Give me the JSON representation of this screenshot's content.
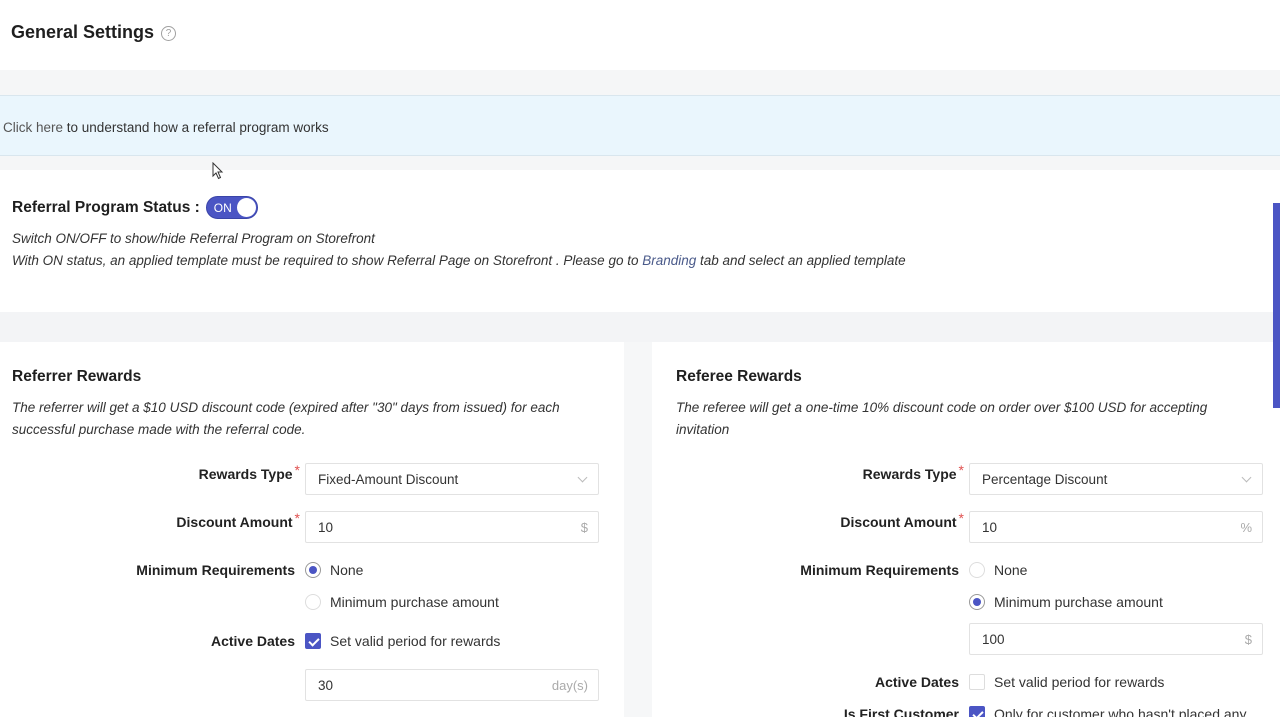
{
  "header": {
    "title": "General Settings",
    "help_icon": "question-circle-icon"
  },
  "info_bar": {
    "link_text": "Click here",
    "text": " to understand how a referral program works"
  },
  "status": {
    "label": "Referral Program Status :",
    "toggle_text": "ON",
    "toggle_on": true,
    "note_line1": "Switch ON/OFF to show/hide Referral Program on Storefront",
    "note_line2_before": "With ON status, an applied template must be required to show Referral Page on Storefront . Please go to ",
    "note_line2_link": "Branding",
    "note_line2_after": " tab and select an applied template"
  },
  "referrer": {
    "title": "Referrer Rewards",
    "description": "The referrer will get a $10 USD discount code (expired after \"30\" days from issued) for each successful purchase made with the referral code.",
    "rewards_type_label": "Rewards Type",
    "rewards_type_value": "Fixed-Amount Discount",
    "discount_amount_label": "Discount Amount",
    "discount_amount_value": "10",
    "discount_amount_suffix": "$",
    "min_req_label": "Minimum Requirements",
    "min_req_options": [
      "None",
      "Minimum purchase amount"
    ],
    "min_req_selected": "None",
    "active_dates_label": "Active Dates",
    "active_dates_check_label": "Set valid period for rewards",
    "active_dates_checked": true,
    "valid_days_value": "30",
    "valid_days_suffix": "day(s)"
  },
  "referee": {
    "title": "Referee Rewards",
    "description": "The referee will get a one-time 10% discount code on order over $100 USD for accepting invitation",
    "rewards_type_label": "Rewards Type",
    "rewards_type_value": "Percentage Discount",
    "discount_amount_label": "Discount Amount",
    "discount_amount_value": "10",
    "discount_amount_suffix": "%",
    "min_req_label": "Minimum Requirements",
    "min_req_options": [
      "None",
      "Minimum purchase amount"
    ],
    "min_req_selected": "Minimum purchase amount",
    "min_purchase_value": "100",
    "min_purchase_suffix": "$",
    "active_dates_label": "Active Dates",
    "active_dates_check_label": "Set valid period for rewards",
    "active_dates_checked": false,
    "first_customer_label": "Is First Customer",
    "first_customer_check_label": "Only for customer who hasn't placed any",
    "first_customer_checked": true
  },
  "colors": {
    "accent": "#4b55c4",
    "info_bar_bg": "#eaf6fd",
    "required": "#e0504f"
  }
}
